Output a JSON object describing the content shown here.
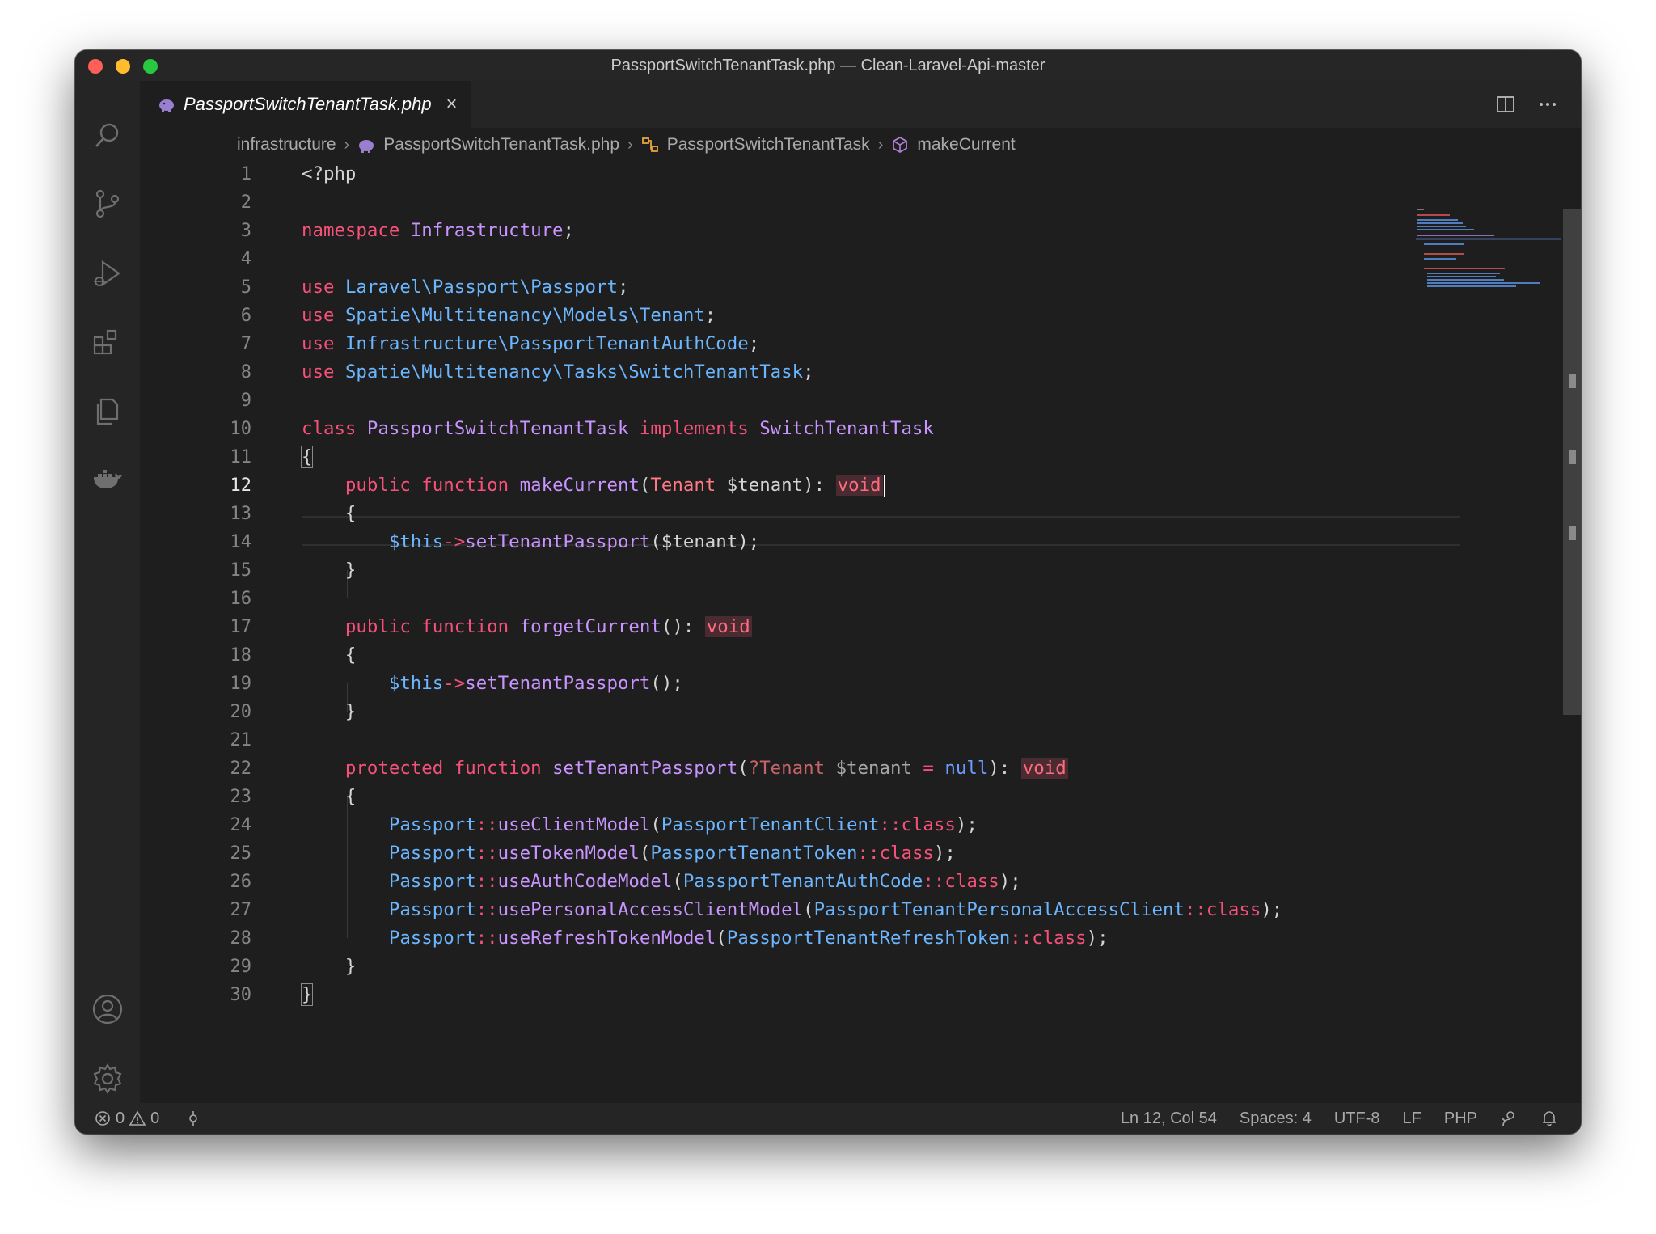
{
  "window": {
    "title": "PassportSwitchTenantTask.php — Clean-Laravel-Api-master"
  },
  "tab": {
    "label": "PassportSwitchTenantTask.php",
    "close_glyph": "×"
  },
  "breadcrumbs": {
    "folder": "infrastructure",
    "file": "PassportSwitchTenantTask.php",
    "class": "PassportSwitchTenantTask",
    "method": "makeCurrent"
  },
  "editor": {
    "active_line": 12,
    "line_numbers": [
      "1",
      "2",
      "3",
      "4",
      "5",
      "6",
      "7",
      "8",
      "9",
      "10",
      "11",
      "12",
      "13",
      "14",
      "15",
      "16",
      "17",
      "18",
      "19",
      "20",
      "21",
      "22",
      "23",
      "24",
      "25",
      "26",
      "27",
      "28",
      "29",
      "30"
    ],
    "tokens": {
      "l1": [
        "<?php"
      ],
      "l3": [
        "namespace",
        " ",
        "Infrastructure",
        ";"
      ],
      "l5": [
        "use",
        " ",
        "Laravel\\Passport\\Passport",
        ";"
      ],
      "l6": [
        "use",
        " ",
        "Spatie\\Multitenancy\\Models\\Tenant",
        ";"
      ],
      "l7": [
        "use",
        " ",
        "Infrastructure\\PassportTenantAuthCode",
        ";"
      ],
      "l8": [
        "use",
        " ",
        "Spatie\\Multitenancy\\Tasks\\SwitchTenantTask",
        ";"
      ],
      "l10": [
        "class",
        " ",
        "PassportSwitchTenantTask",
        " ",
        "implements",
        " ",
        "SwitchTenantTask"
      ],
      "l11": [
        "{"
      ],
      "l12": [
        "    ",
        "public",
        " ",
        "function",
        " ",
        "makeCurrent",
        "(",
        "Tenant",
        " ",
        "$tenant",
        "): ",
        "void"
      ],
      "l13": [
        "    {"
      ],
      "l14": [
        "        ",
        "$this",
        "->",
        "setTenantPassport",
        "(",
        "$tenant",
        ");"
      ],
      "l15": [
        "    }"
      ],
      "l17": [
        "    ",
        "public",
        " ",
        "function",
        " ",
        "forgetCurrent",
        "(): ",
        "void"
      ],
      "l18": [
        "    {"
      ],
      "l19": [
        "        ",
        "$this",
        "->",
        "setTenantPassport",
        "();"
      ],
      "l20": [
        "    }"
      ],
      "l22": [
        "    ",
        "protected",
        " ",
        "function",
        " ",
        "setTenantPassport",
        "(",
        "?Tenant",
        " ",
        "$tenant",
        " = ",
        "null",
        "): ",
        "void"
      ],
      "l23": [
        "    {"
      ],
      "l24": [
        "        ",
        "Passport",
        "::",
        "useClientModel",
        "(",
        "PassportTenantClient",
        "::",
        "class",
        ");"
      ],
      "l25": [
        "        ",
        "Passport",
        "::",
        "useTokenModel",
        "(",
        "PassportTenantToken",
        "::",
        "class",
        ");"
      ],
      "l26": [
        "        ",
        "Passport",
        "::",
        "useAuthCodeModel",
        "(",
        "PassportTenantAuthCode",
        "::",
        "class",
        ");"
      ],
      "l27": [
        "        ",
        "Passport",
        "::",
        "usePersonalAccessClientModel",
        "(",
        "PassportTenantPersonalAccessClient",
        "::",
        "class",
        ");"
      ],
      "l28": [
        "        ",
        "Passport",
        "::",
        "useRefreshTokenModel",
        "(",
        "PassportTenantRefreshToken",
        "::",
        "class",
        ");"
      ],
      "l29": [
        "    }"
      ],
      "l30": [
        "}"
      ]
    }
  },
  "statusbar": {
    "errors": "0",
    "warnings": "0",
    "position": "Ln 12, Col 54",
    "spaces": "Spaces: 4",
    "encoding": "UTF-8",
    "eol": "LF",
    "language": "PHP"
  },
  "colors": {
    "keyword": "#f7517a",
    "namespace": "#6cb6ff",
    "class": "#c994ff",
    "void_bg": "#4a2b31"
  },
  "icons": {
    "activity": [
      "search-icon",
      "source-control-icon",
      "run-debug-icon",
      "extensions-icon",
      "explorer-icon",
      "docker-icon",
      "account-icon",
      "settings-gear-icon"
    ],
    "tab_actions": [
      "split-editor-icon",
      "more-actions-icon"
    ]
  }
}
